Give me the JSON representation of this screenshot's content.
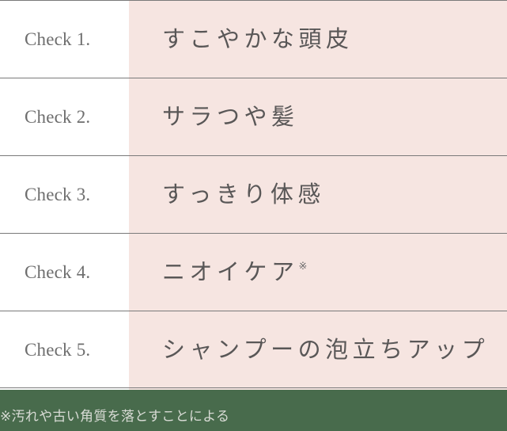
{
  "table": {
    "rows": [
      {
        "label": "Check 1.",
        "text": "すこやかな頭皮",
        "note_mark": ""
      },
      {
        "label": "Check 2.",
        "text": "サラつや髪",
        "note_mark": ""
      },
      {
        "label": "Check 3.",
        "text": "すっきり体感",
        "note_mark": ""
      },
      {
        "label": "Check 4.",
        "text": "ニオイケア",
        "note_mark": "※"
      },
      {
        "label": "Check 5.",
        "text": "シャンプーの泡立ちアップ",
        "note_mark": ""
      }
    ]
  },
  "footer": {
    "note": "※汚れや古い角質を落とすことによる"
  },
  "colors": {
    "pink_column": "#f6e5e1",
    "footer_background": "#486b4c",
    "footer_text": "#d8dbd5",
    "divider": "#7a7a7a",
    "label_text": "#6e6e6e",
    "body_text": "#595757",
    "page_background": "#ffffff"
  }
}
